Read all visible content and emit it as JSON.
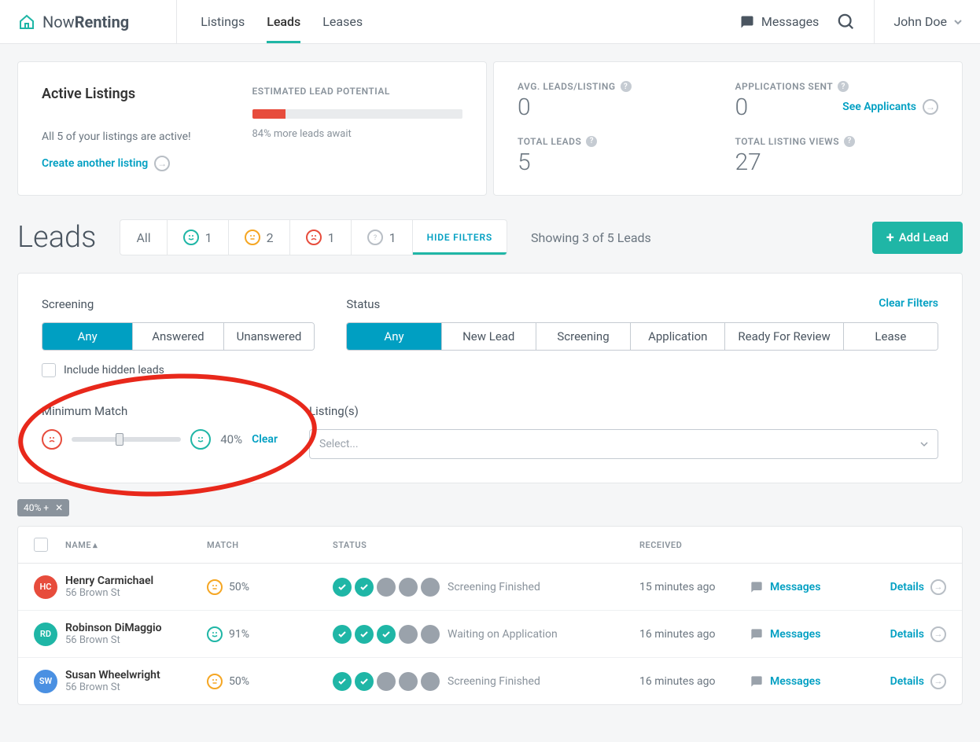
{
  "brand": {
    "a": "Now",
    "b": "Renting"
  },
  "nav": {
    "listings": "Listings",
    "leads": "Leads",
    "leases": "Leases"
  },
  "header": {
    "messages": "Messages",
    "user": "John Doe"
  },
  "active": {
    "title": "Active Listings",
    "subtitle": "All 5 of your listings are active!",
    "cta": "Create another listing"
  },
  "potential": {
    "label": "ESTIMATED LEAD POTENTIAL",
    "sub": "84% more leads await"
  },
  "stats": {
    "avg_label": "AVG. LEADS/LISTING",
    "avg": "0",
    "sent_label": "APPLICATIONS SENT",
    "sent": "0",
    "see": "See Applicants",
    "total_label": "TOTAL LEADS",
    "total": "5",
    "views_label": "TOTAL LISTING VIEWS",
    "views": "27"
  },
  "page_title": "Leads",
  "tabs": {
    "all": "All",
    "happy": "1",
    "neutral": "2",
    "sad": "1",
    "unknown": "1",
    "hide": "HIDE FILTERS"
  },
  "showing": "Showing 3 of 5 Leads",
  "add_lead": "Add Lead",
  "filters": {
    "screening_label": "Screening",
    "screening": {
      "any": "Any",
      "answered": "Answered",
      "unanswered": "Unanswered"
    },
    "status_label": "Status",
    "status": {
      "any": "Any",
      "new": "New Lead",
      "scr": "Screening",
      "app": "Application",
      "ready": "Ready For Review",
      "lease": "Lease"
    },
    "clear": "Clear Filters",
    "include_hidden": "Include hidden leads",
    "min_match": "Minimum Match",
    "min_val": "40%",
    "clear_min": "Clear",
    "listings_label": "Listing(s)",
    "select_placeholder": "Select..."
  },
  "chip": "40% +",
  "thead": {
    "name": "NAME",
    "match": "MATCH",
    "status": "STATUS",
    "received": "RECEIVED"
  },
  "rows": [
    {
      "init": "HC",
      "color": "#e74c3c",
      "name": "Henry Carmichael",
      "sub": "56 Brown St",
      "match": "50%",
      "mood": "neutral",
      "done": 2,
      "status": "Screening Finished",
      "recv": "15 minutes ago"
    },
    {
      "init": "RD",
      "color": "#1fb6a6",
      "name": "Robinson DiMaggio",
      "sub": "56 Brown St",
      "match": "91%",
      "mood": "happy",
      "done": 3,
      "status": "Waiting on Application",
      "recv": "16 minutes ago"
    },
    {
      "init": "SW",
      "color": "#4a90e2",
      "name": "Susan Wheelwright",
      "sub": "56 Brown St",
      "match": "50%",
      "mood": "neutral",
      "done": 2,
      "status": "Screening Finished",
      "recv": "16 minutes ago"
    }
  ],
  "msg_label": "Messages",
  "details_label": "Details"
}
